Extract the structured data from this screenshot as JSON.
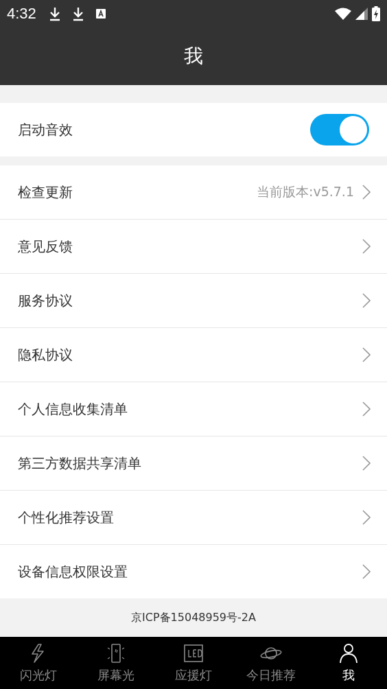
{
  "status_bar": {
    "time": "4:32"
  },
  "header": {
    "title": "我"
  },
  "sound_setting": {
    "label": "启动音效",
    "on": true
  },
  "menu": [
    {
      "label": "检查更新",
      "value": "当前版本:v5.7.1"
    },
    {
      "label": "意见反馈"
    },
    {
      "label": "服务协议"
    },
    {
      "label": "隐私协议"
    },
    {
      "label": "个人信息收集清单"
    },
    {
      "label": "第三方数据共享清单"
    },
    {
      "label": "个性化推荐设置"
    },
    {
      "label": "设备信息权限设置"
    }
  ],
  "footer": {
    "text": "京ICP备15048959号-2A"
  },
  "bottom_nav": [
    {
      "label": "闪光灯",
      "kind": "flash",
      "selected": false
    },
    {
      "label": "屏幕光",
      "kind": "screen",
      "selected": false
    },
    {
      "label": "应援灯",
      "kind": "led",
      "selected": false
    },
    {
      "label": "今日推荐",
      "kind": "planet",
      "selected": false
    },
    {
      "label": "我",
      "kind": "person",
      "selected": true
    }
  ]
}
